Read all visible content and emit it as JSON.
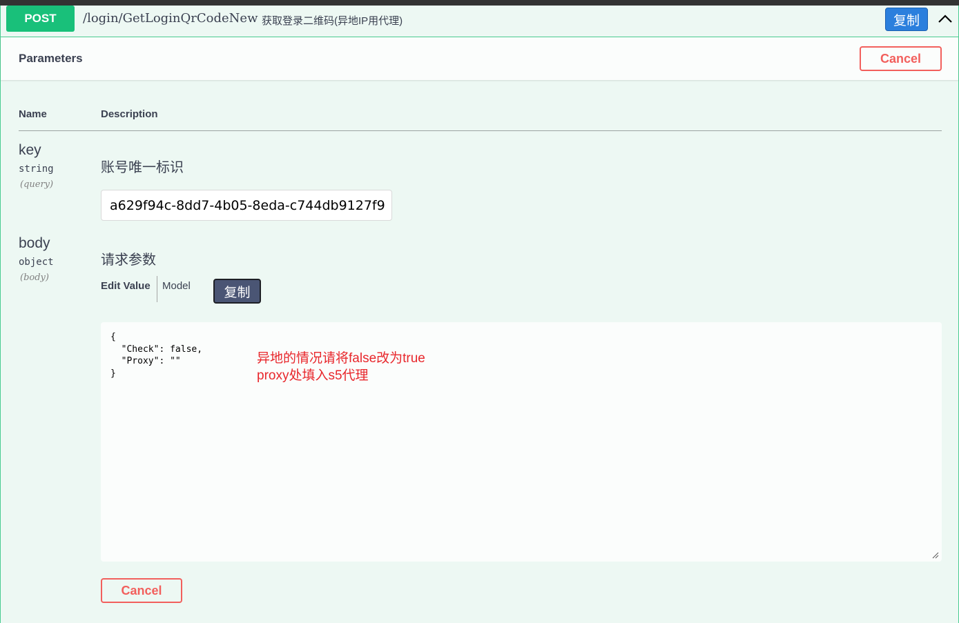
{
  "endpoint": {
    "method": "POST",
    "path": "/login/GetLoginQrCodeNew",
    "description": "获取登录二维码(异地IP用代理)",
    "copy_label": "复制"
  },
  "parameters": {
    "title": "Parameters",
    "cancel_label": "Cancel",
    "columns": {
      "name": "Name",
      "description": "Description"
    }
  },
  "params": [
    {
      "name": "key",
      "type": "string",
      "in": "(query)",
      "description": "账号唯一标识",
      "value": "a629f94c-8dd7-4b05-8eda-c744db9127f9"
    },
    {
      "name": "body",
      "type": "object",
      "in": "(body)",
      "description": "请求参数",
      "tabs": {
        "edit_value": "Edit Value",
        "model": "Model"
      },
      "copy_label": "复制",
      "value": "{\n  \"Check\": false,\n  \"Proxy\": \"\"\n}",
      "note": "异地的情况请将false改为true\nproxy处填入s5代理"
    }
  ],
  "footer": {
    "cancel_label": "Cancel"
  },
  "colors": {
    "post": "#19c07a",
    "post_border": "#49cc90",
    "background": "#edf8f3",
    "cancel": "#f25f5c",
    "copy_primary": "#2b7fdd",
    "copy_body": "#4a5574",
    "note": "#e8262b"
  },
  "icons": {
    "collapse": "chevron-up-icon",
    "resize": "resize-grip-icon"
  }
}
